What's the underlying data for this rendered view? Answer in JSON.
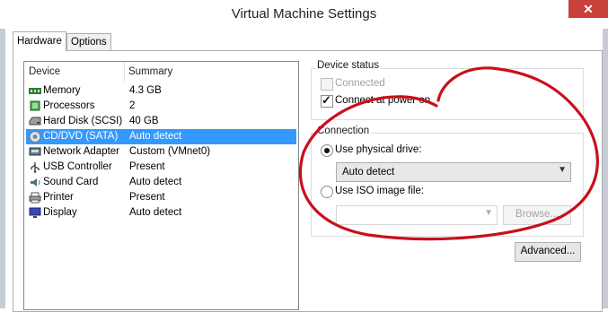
{
  "window": {
    "title": "Virtual Machine Settings",
    "close_glyph": "✕"
  },
  "tabs": [
    {
      "label": "Hardware"
    },
    {
      "label": "Options"
    }
  ],
  "device_list": {
    "col_device": "Device",
    "col_summary": "Summary",
    "items": [
      {
        "name": "Memory",
        "summary": "4.3 GB",
        "icon": "memory-icon"
      },
      {
        "name": "Processors",
        "summary": "2",
        "icon": "processor-icon"
      },
      {
        "name": "Hard Disk (SCSI)",
        "summary": "40 GB",
        "icon": "hard-disk-icon"
      },
      {
        "name": "CD/DVD (SATA)",
        "summary": "Auto detect",
        "icon": "cd-dvd-icon",
        "selected": true
      },
      {
        "name": "Network Adapter",
        "summary": "Custom (VMnet0)",
        "icon": "network-adapter-icon"
      },
      {
        "name": "USB Controller",
        "summary": "Present",
        "icon": "usb-icon"
      },
      {
        "name": "Sound Card",
        "summary": "Auto detect",
        "icon": "sound-card-icon"
      },
      {
        "name": "Printer",
        "summary": "Present",
        "icon": "printer-icon"
      },
      {
        "name": "Display",
        "summary": "Auto detect",
        "icon": "display-icon"
      }
    ]
  },
  "device_status": {
    "label": "Device status",
    "connected_label": "Connected",
    "connected_checked": false,
    "connected_enabled": false,
    "power_on_label": "Connect at power on",
    "power_on_checked": true
  },
  "connection": {
    "label": "Connection",
    "physical_label": "Use physical drive:",
    "physical_selected": true,
    "drive_value": "Auto detect",
    "iso_label": "Use ISO image file:",
    "iso_selected": false,
    "iso_value": "",
    "browse_label": "Browse..."
  },
  "advanced_label": "Advanced...",
  "colors": {
    "selection": "#3399ff",
    "annotation": "#c8101c",
    "close": "#c7403a"
  }
}
